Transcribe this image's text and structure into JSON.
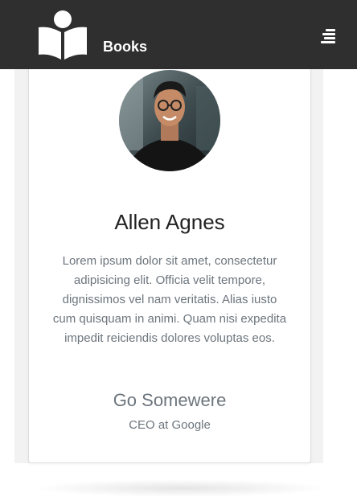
{
  "header": {
    "brand": "Books",
    "logo_icon": "book-reader-icon",
    "menu_icon": "hamburger-menu-icon"
  },
  "profile": {
    "avatar_icon": "avatar-photo",
    "name": "Allen Agnes",
    "bio": "Lorem ipsum dolor sit amet, consectetur adipisicing elit. Officia velit tempore, dignissimos vel nam veritatis. Alias iusto cum quisquam in animi. Quam nisi expedita impedit reiciendis dolores voluptas eos.",
    "link": "Go Somewere",
    "role": "CEO at Google"
  },
  "colors": {
    "header_bg": "#2f2f2f",
    "text_muted": "#6c757d",
    "text_dark": "#222222"
  }
}
